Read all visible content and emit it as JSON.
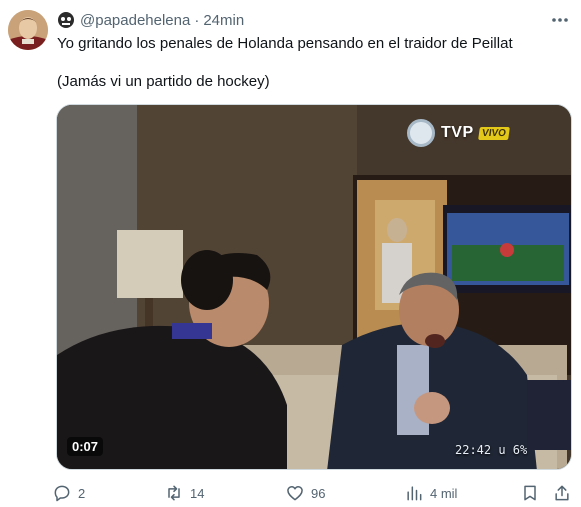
{
  "tweet": {
    "handle": "@papadehelena",
    "separator": "·",
    "time": "24min",
    "text_line_1": "Yo gritando los penales de Holanda pensando en el traidor de Peillat",
    "text_line_2": "(Jamás vi un partido de hockey)"
  },
  "video": {
    "duration": "0:07",
    "broadcaster": "TVP",
    "live_badge": "VIVO",
    "on_screen_time": "22:42 u 6%"
  },
  "actions": {
    "replies": "2",
    "reposts": "14",
    "likes": "96",
    "views": "4 mil"
  },
  "icons": {
    "more": "more-horizontal-icon",
    "reply": "reply-icon",
    "repost": "repost-icon",
    "like": "heart-icon",
    "views": "views-chart-icon",
    "bookmark": "bookmark-icon",
    "share": "share-icon"
  },
  "colors": {
    "text_primary": "#0f1419",
    "text_secondary": "#536471",
    "border": "#cfd9de",
    "live_badge": "#e3c81a"
  }
}
